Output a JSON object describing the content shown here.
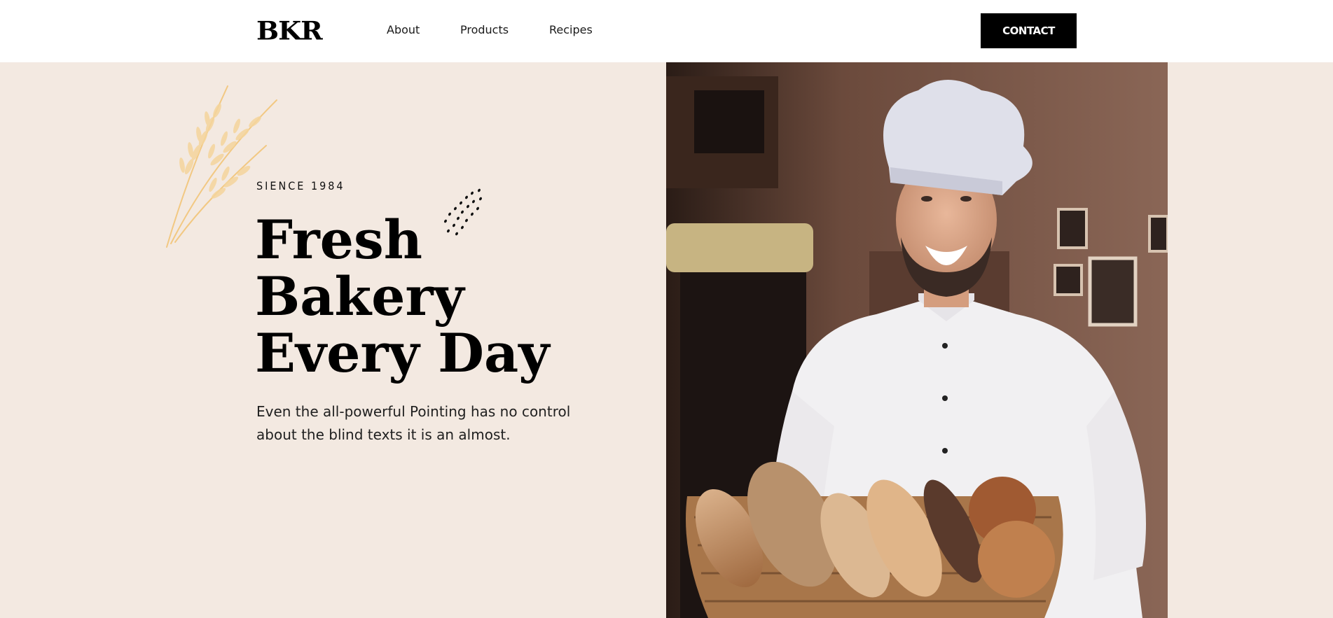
{
  "header": {
    "logo": "BKR",
    "nav": [
      {
        "label": "About"
      },
      {
        "label": "Products"
      },
      {
        "label": "Recipes"
      }
    ],
    "contact_label": "CONTACT"
  },
  "hero": {
    "eyebrow": "SIENCE 1984",
    "headline_lines": [
      "Fresh",
      "Bakery",
      "Every Day"
    ],
    "description": "Even the all-powerful Pointing has no control about the blind texts it is an almost."
  },
  "colors": {
    "background": "#f3e9e1",
    "header_bg": "#ffffff",
    "accent_wheat": "#f2c882",
    "button_bg": "#000000",
    "text": "#000000"
  },
  "icons": [
    "wheat-decoration-icon",
    "dots-decoration-icon"
  ]
}
